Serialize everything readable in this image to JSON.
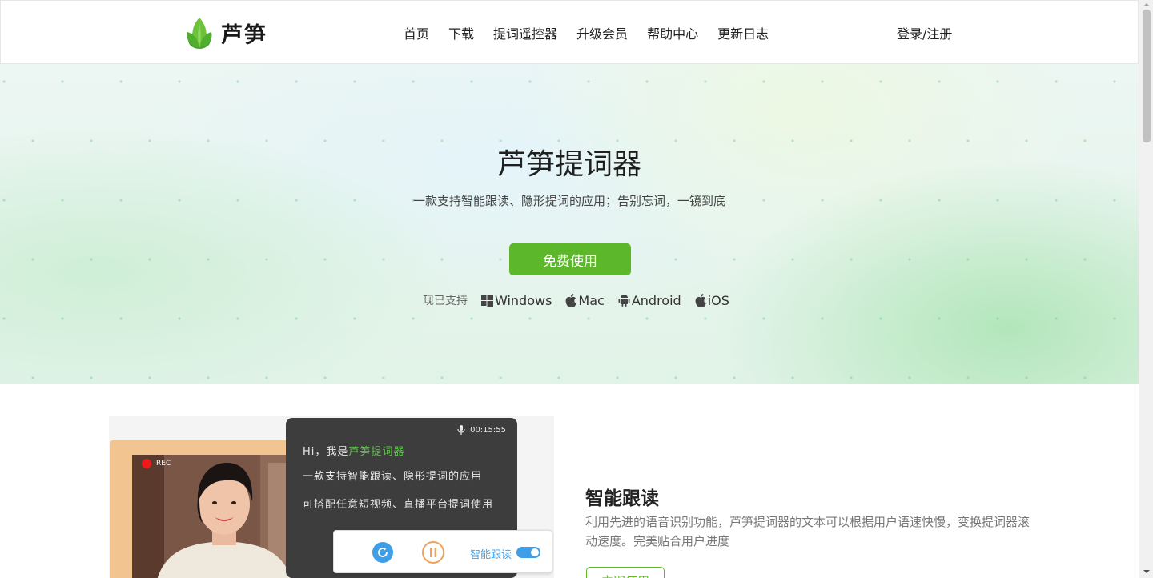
{
  "header": {
    "brand": "芦笋",
    "nav": [
      "首页",
      "下载",
      "提词遥控器",
      "升级会员",
      "帮助中心",
      "更新日志"
    ],
    "login": "登录/注册"
  },
  "hero": {
    "title": "芦笋提词器",
    "subtitle": "一款支持智能跟读、隐形提词的应用；告别忘词，一镜到底",
    "cta": "免费使用",
    "support_label": "现已支持",
    "platforms": [
      {
        "name": "Windows",
        "icon": "windows-icon"
      },
      {
        "name": "Mac",
        "icon": "apple-icon"
      },
      {
        "name": "Android",
        "icon": "android-icon"
      },
      {
        "name": "iOS",
        "icon": "apple-icon"
      }
    ]
  },
  "demo": {
    "rec": "REC",
    "timer": "00:15:55",
    "line1_prefix": "Hi，我是",
    "line1_highlight": "芦笋提词器",
    "line2": "一款支持智能跟读、隐形提词的应用",
    "line3": "可搭配任意短视频、直播平台提词使用",
    "toggle_label": "智能跟读"
  },
  "feature": {
    "title": "智能跟读",
    "description": "利用先进的语音识别功能，芦笋提词器的文本可以根据用户语速快慢，变换提词器滚动速度。完美贴合用户进度",
    "button": "立即使用"
  },
  "colors": {
    "brand_green": "#5cb82a",
    "highlight_green": "#5cc44a",
    "accent_blue": "#3f9ee8",
    "pause_orange": "#f2a15c",
    "rec_red": "#f01919"
  }
}
